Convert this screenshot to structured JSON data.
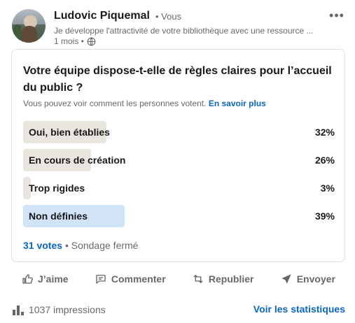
{
  "post": {
    "author": "Ludovic Piquemal",
    "you_tag": "• Vous",
    "subtitle": "Je développe l'attractivité de votre bibliothèque avec une ressource ...",
    "timestamp": "1 mois •",
    "more_label": "•••"
  },
  "poll": {
    "question": "Votre équipe dispose-t-elle de règles claires pour l’accueil du public ?",
    "visibility_text": "Vous pouvez voir comment les personnes votent.",
    "learn_more": "En savoir plus",
    "options": [
      {
        "label": "Oui, bien établies",
        "percent": "32%",
        "share": 0.32
      },
      {
        "label": "En cours de création",
        "percent": "26%",
        "share": 0.26
      },
      {
        "label": "Trop rigides",
        "percent": "3%",
        "share": 0.03
      },
      {
        "label": "Non définies",
        "percent": "39%",
        "share": 0.39,
        "selected": true
      }
    ],
    "votes": "31 votes",
    "status": "• Sondage fermé"
  },
  "actions": {
    "like": "J’aime",
    "comment": "Commenter",
    "repost": "Republier",
    "send": "Envoyer"
  },
  "stats": {
    "impressions": "1037 impressions",
    "view_stats": "Voir les statistiques"
  },
  "colors": {
    "link": "#0a66c2",
    "bar": "#e9e5df",
    "bar_selected": "#d0e3f7"
  }
}
